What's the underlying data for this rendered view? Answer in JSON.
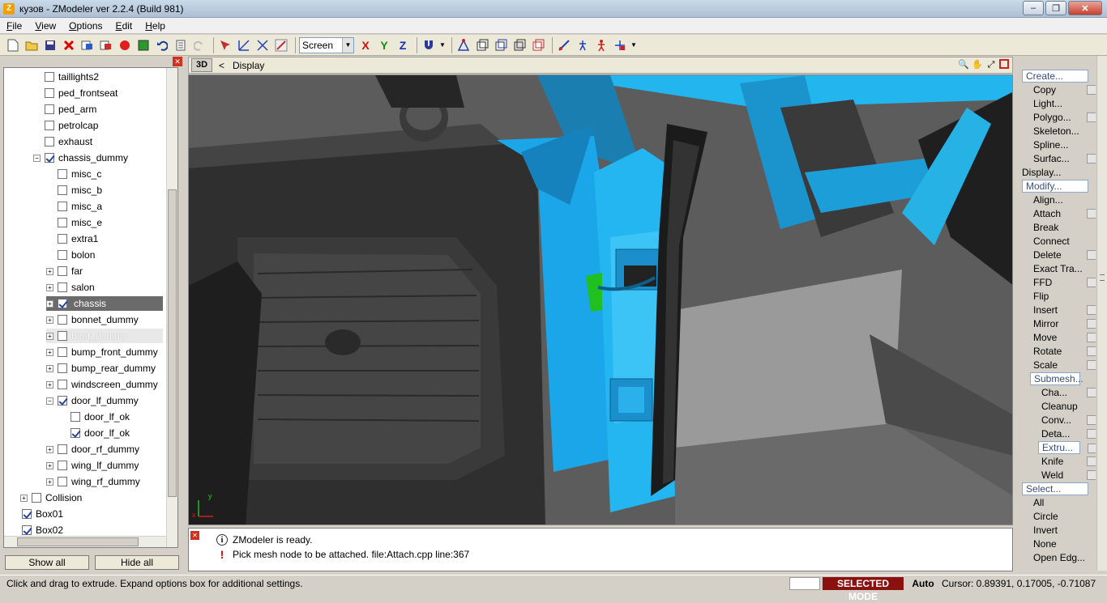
{
  "window": {
    "app_icon": "Z",
    "title": "кузов - ZModeler ver 2.2.4 (Build 981)",
    "min_symbol": "–",
    "max_symbol": "❐",
    "close_symbol": "✕"
  },
  "menu": [
    "File",
    "View",
    "Options",
    "Edit",
    "Help"
  ],
  "toolbar": {
    "view_select_value": "Screen",
    "axis_x": "X",
    "axis_y": "Y",
    "axis_z": "Z"
  },
  "tree": {
    "items": [
      {
        "label": "taillights2",
        "checked": false,
        "expander": "",
        "level": 2
      },
      {
        "label": "ped_frontseat",
        "checked": false,
        "expander": "",
        "level": 2
      },
      {
        "label": "ped_arm",
        "checked": false,
        "expander": "",
        "level": 2
      },
      {
        "label": "petrolcap",
        "checked": false,
        "expander": "",
        "level": 2
      },
      {
        "label": "exhaust",
        "checked": false,
        "expander": "",
        "level": 2
      },
      {
        "label": "chassis_dummy",
        "checked": true,
        "expander": "−",
        "level": 2
      },
      {
        "label": "misc_c",
        "checked": false,
        "expander": "",
        "level": 3
      },
      {
        "label": "misc_b",
        "checked": false,
        "expander": "",
        "level": 3
      },
      {
        "label": "misc_a",
        "checked": false,
        "expander": "",
        "level": 3
      },
      {
        "label": "misc_e",
        "checked": false,
        "expander": "",
        "level": 3
      },
      {
        "label": "extra1",
        "checked": false,
        "expander": "",
        "level": 3
      },
      {
        "label": "bolon",
        "checked": false,
        "expander": "",
        "level": 3
      },
      {
        "label": "far",
        "checked": false,
        "expander": "+",
        "level": 3
      },
      {
        "label": "salon",
        "checked": false,
        "expander": "+",
        "level": 3
      },
      {
        "label": "chassis",
        "checked": true,
        "expander": "+",
        "level": 3,
        "state": "selected"
      },
      {
        "label": "bonnet_dummy",
        "checked": false,
        "expander": "+",
        "level": 3
      },
      {
        "label": "boot_dummy",
        "checked": false,
        "expander": "+",
        "level": 3,
        "state": "greyed"
      },
      {
        "label": "bump_front_dummy",
        "checked": false,
        "expander": "+",
        "level": 3
      },
      {
        "label": "bump_rear_dummy",
        "checked": false,
        "expander": "+",
        "level": 3
      },
      {
        "label": "windscreen_dummy",
        "checked": false,
        "expander": "+",
        "level": 3
      },
      {
        "label": "door_lf_dummy",
        "checked": true,
        "expander": "−",
        "level": 3
      },
      {
        "label": "door_lf_ok",
        "checked": false,
        "expander": "",
        "level": 4
      },
      {
        "label": "door_lf_ok",
        "checked": true,
        "expander": "",
        "level": 4
      },
      {
        "label": "door_rf_dummy",
        "checked": false,
        "expander": "+",
        "level": 3
      },
      {
        "label": "wing_lf_dummy",
        "checked": false,
        "expander": "+",
        "level": 3
      },
      {
        "label": "wing_rf_dummy",
        "checked": false,
        "expander": "+",
        "level": 3
      },
      {
        "label": "Collision",
        "checked": false,
        "expander": "+",
        "level": 1
      },
      {
        "label": "Box01",
        "checked": true,
        "expander": "",
        "level": 0
      },
      {
        "label": "Box02",
        "checked": true,
        "expander": "",
        "level": 0
      }
    ],
    "show_all": "Show all",
    "hide_all": "Hide all"
  },
  "viewport": {
    "mode_tag": "3D",
    "arrow": "<",
    "name": "Display",
    "axis_gizmo_x": "x",
    "axis_gizmo_y": "y"
  },
  "log": {
    "info_icon": "i",
    "warn_icon": "!",
    "lines": [
      {
        "icon": "info",
        "text": "ZModeler is ready."
      },
      {
        "icon": "warn",
        "text": "Pick mesh node to be attached. file:Attach.cpp line:367"
      }
    ]
  },
  "commands": [
    {
      "label": "Create...",
      "kind": "section",
      "indent": 0,
      "opt": false
    },
    {
      "label": "Copy",
      "kind": "item",
      "indent": 1,
      "opt": true
    },
    {
      "label": "Light...",
      "kind": "item",
      "indent": 1,
      "opt": false
    },
    {
      "label": "Polygo...",
      "kind": "item",
      "indent": 1,
      "opt": true
    },
    {
      "label": "Skeleton...",
      "kind": "item",
      "indent": 1,
      "opt": false
    },
    {
      "label": "Spline...",
      "kind": "item",
      "indent": 1,
      "opt": false
    },
    {
      "label": "Surfac...",
      "kind": "item",
      "indent": 1,
      "opt": true
    },
    {
      "label": "Display...",
      "kind": "item",
      "indent": 0,
      "opt": false
    },
    {
      "label": "Modify...",
      "kind": "section",
      "indent": 0,
      "opt": false
    },
    {
      "label": "Align...",
      "kind": "item",
      "indent": 1,
      "opt": false
    },
    {
      "label": "Attach",
      "kind": "item",
      "indent": 1,
      "opt": true
    },
    {
      "label": "Break",
      "kind": "item",
      "indent": 1,
      "opt": false
    },
    {
      "label": "Connect",
      "kind": "item",
      "indent": 1,
      "opt": false
    },
    {
      "label": "Delete",
      "kind": "item",
      "indent": 1,
      "opt": true
    },
    {
      "label": "Exact Tra...",
      "kind": "item",
      "indent": 1,
      "opt": false
    },
    {
      "label": "FFD",
      "kind": "item",
      "indent": 1,
      "opt": true
    },
    {
      "label": "Flip",
      "kind": "item",
      "indent": 1,
      "opt": false
    },
    {
      "label": "Insert",
      "kind": "item",
      "indent": 1,
      "opt": true
    },
    {
      "label": "Mirror",
      "kind": "item",
      "indent": 1,
      "opt": true
    },
    {
      "label": "Move",
      "kind": "item",
      "indent": 1,
      "opt": true
    },
    {
      "label": "Rotate",
      "kind": "item",
      "indent": 1,
      "opt": true
    },
    {
      "label": "Scale",
      "kind": "item",
      "indent": 1,
      "opt": true
    },
    {
      "label": "Submesh...",
      "kind": "sub",
      "indent": 1,
      "opt": false
    },
    {
      "label": "Cha...",
      "kind": "item",
      "indent": 2,
      "opt": true
    },
    {
      "label": "Cleanup",
      "kind": "item",
      "indent": 2,
      "opt": false
    },
    {
      "label": "Conv...",
      "kind": "item",
      "indent": 2,
      "opt": true
    },
    {
      "label": "Deta...",
      "kind": "item",
      "indent": 2,
      "opt": true
    },
    {
      "label": "Extru...",
      "kind": "sub",
      "indent": 2,
      "opt": true
    },
    {
      "label": "Knife",
      "kind": "item",
      "indent": 2,
      "opt": true
    },
    {
      "label": "Weld",
      "kind": "item",
      "indent": 2,
      "opt": true
    },
    {
      "label": "Select...",
      "kind": "section",
      "indent": 0,
      "opt": false
    },
    {
      "label": "All",
      "kind": "item",
      "indent": 1,
      "opt": false
    },
    {
      "label": "Circle",
      "kind": "item",
      "indent": 1,
      "opt": false
    },
    {
      "label": "Invert",
      "kind": "item",
      "indent": 1,
      "opt": false
    },
    {
      "label": "None",
      "kind": "item",
      "indent": 1,
      "opt": false
    },
    {
      "label": "Open Edg...",
      "kind": "item",
      "indent": 1,
      "opt": false
    }
  ],
  "statusbar": {
    "hint": "Click and drag to extrude. Expand options box for additional settings.",
    "mode": "SELECTED MODE",
    "auto": "Auto",
    "cursor": "Cursor: 0.89391, 0.17005, -0.71087"
  },
  "colors": {
    "mesh_blue": "#1aa6e8",
    "mode_bg": "#8b1010",
    "section_text": "#3a4d7a"
  }
}
